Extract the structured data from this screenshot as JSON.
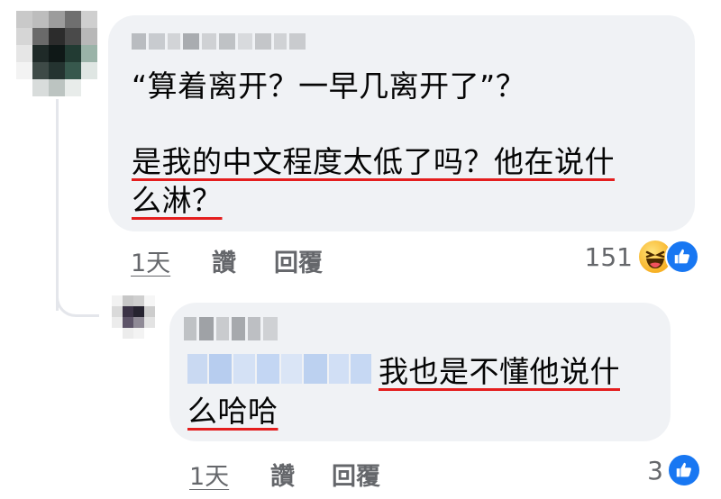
{
  "comment": {
    "line1": "“算着离开？一早几离开了”？",
    "line2": "是我的中文程度太低了吗？他在说什",
    "line3": "么淋？",
    "time": "1天",
    "like_label": "讚",
    "reply_label": "回覆",
    "reaction_count": "151",
    "reactions": [
      "haha-emoji-icon",
      "like-thumb-icon"
    ]
  },
  "reply": {
    "line1": "我也是不懂他说什",
    "line2": "么哈哈",
    "time": "1天",
    "like_label": "讚",
    "reply_label": "回覆",
    "reaction_count": "3",
    "reactions": [
      "like-thumb-icon"
    ]
  },
  "colors": {
    "bubble": "#f0f2f5",
    "underline": "#e41e1e",
    "meta": "#65676b",
    "like_blue": "#1877f2"
  }
}
